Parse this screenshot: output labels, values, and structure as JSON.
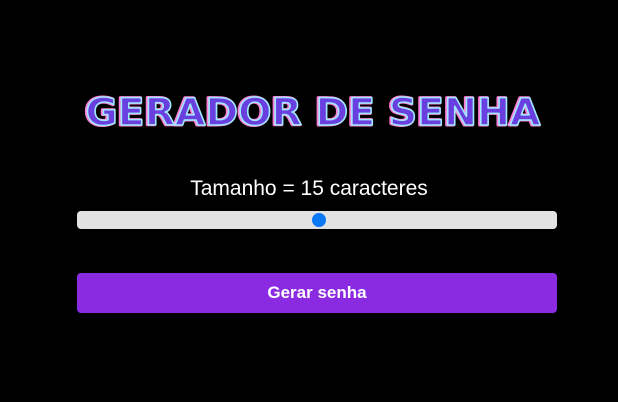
{
  "header": {
    "title": "GERADOR DE SENHA"
  },
  "controls": {
    "size_label": "Tamanho = 15 caracteres",
    "slider_level": 0.5,
    "generate_button": "Gerar senha"
  },
  "colors": {
    "background": "#000000",
    "accent": "#8a2be2",
    "title_fill": "#6a3fe0",
    "title_highlight": "#9fe8ff",
    "slider_track": "#e2e2e2",
    "slider_thumb": "#0b78f5"
  }
}
